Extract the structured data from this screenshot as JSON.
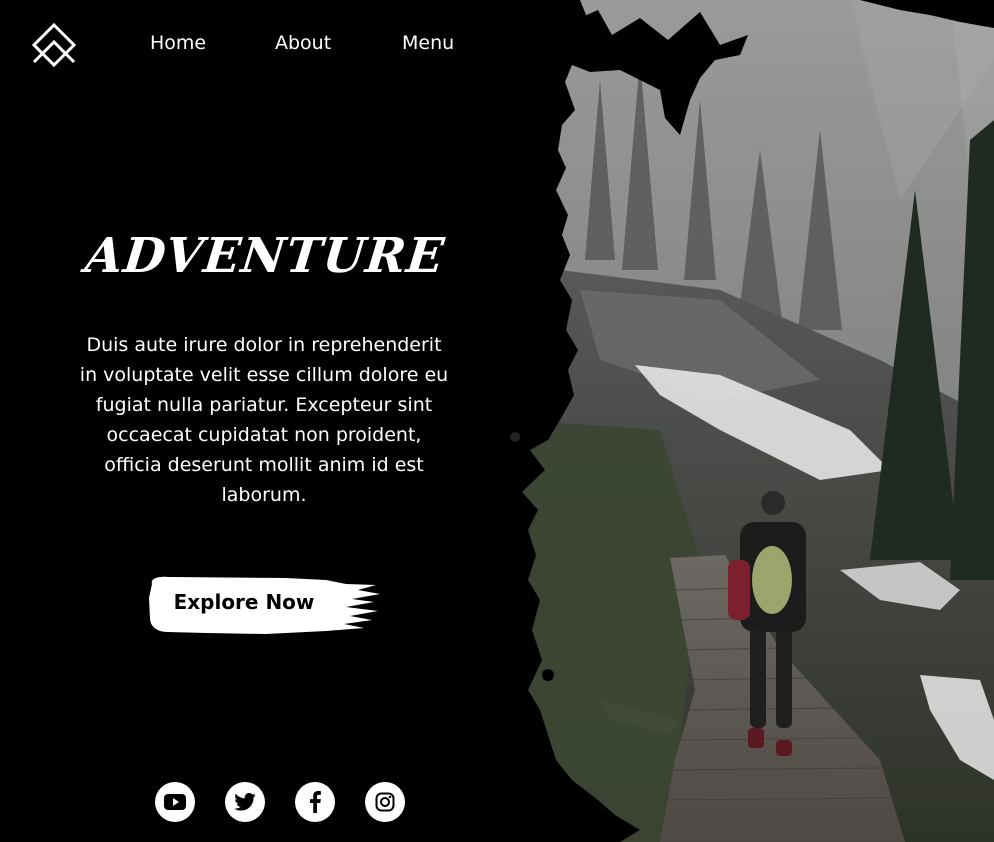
{
  "nav": {
    "logo_icon": "mountain-diamond-logo",
    "links": [
      {
        "label": "Home"
      },
      {
        "label": "About"
      },
      {
        "label": "Menu"
      }
    ]
  },
  "hero": {
    "title": "ADVENTURE",
    "description": "Duis aute irure dolor in reprehenderit in voluptate velit esse cillum dolore eu fugiat nulla pariatur. Excepteur sint occaecat cupidatat non proident, officia deserunt mollit anim id est laborum.",
    "cta_label": "Explore Now"
  },
  "social": [
    {
      "icon": "youtube-icon"
    },
    {
      "icon": "twitter-icon"
    },
    {
      "icon": "facebook-icon"
    },
    {
      "icon": "instagram-icon"
    }
  ],
  "colors": {
    "background": "#000000",
    "text": "#ffffff",
    "button_bg": "#ffffff",
    "button_text": "#000000"
  }
}
